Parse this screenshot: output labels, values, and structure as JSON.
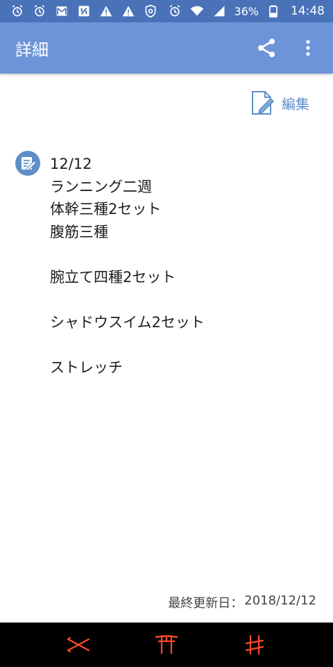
{
  "status_bar": {
    "left_icons": [
      "alarm-icon",
      "alarm-icon",
      "mail-icon",
      "app-icon",
      "warning-icon",
      "warning-icon",
      "vpn-shield-icon"
    ],
    "right_icons": [
      "alarm-icon",
      "wifi-icon",
      "signal-icon"
    ],
    "battery": "36%",
    "time": "14:48"
  },
  "app_bar": {
    "title": "詳細",
    "share_icon": "share-icon",
    "menu_icon": "more-vert-icon"
  },
  "edit": {
    "label": "編集",
    "icon": "edit-document-icon"
  },
  "memo": {
    "icon": "memo-icon",
    "text": "12/12\nランニング二週\n体幹三種2セット\n腹筋三種\n\n腕立て四種2セット\n\nシャドウスイム2セット\n\nストレッチ"
  },
  "footer": {
    "last_updated_label": "最終更新日：",
    "last_updated_value": "2018/12/12"
  },
  "colors": {
    "status_bar": "#4a72b9",
    "app_bar": "#6d94d9",
    "accent": "#5f8fc9",
    "nav_icon": "#ff4b2b",
    "nav_bg": "#000000"
  },
  "bottom_nav": {
    "items": [
      "recents-icon",
      "home-icon",
      "back-icon"
    ]
  }
}
